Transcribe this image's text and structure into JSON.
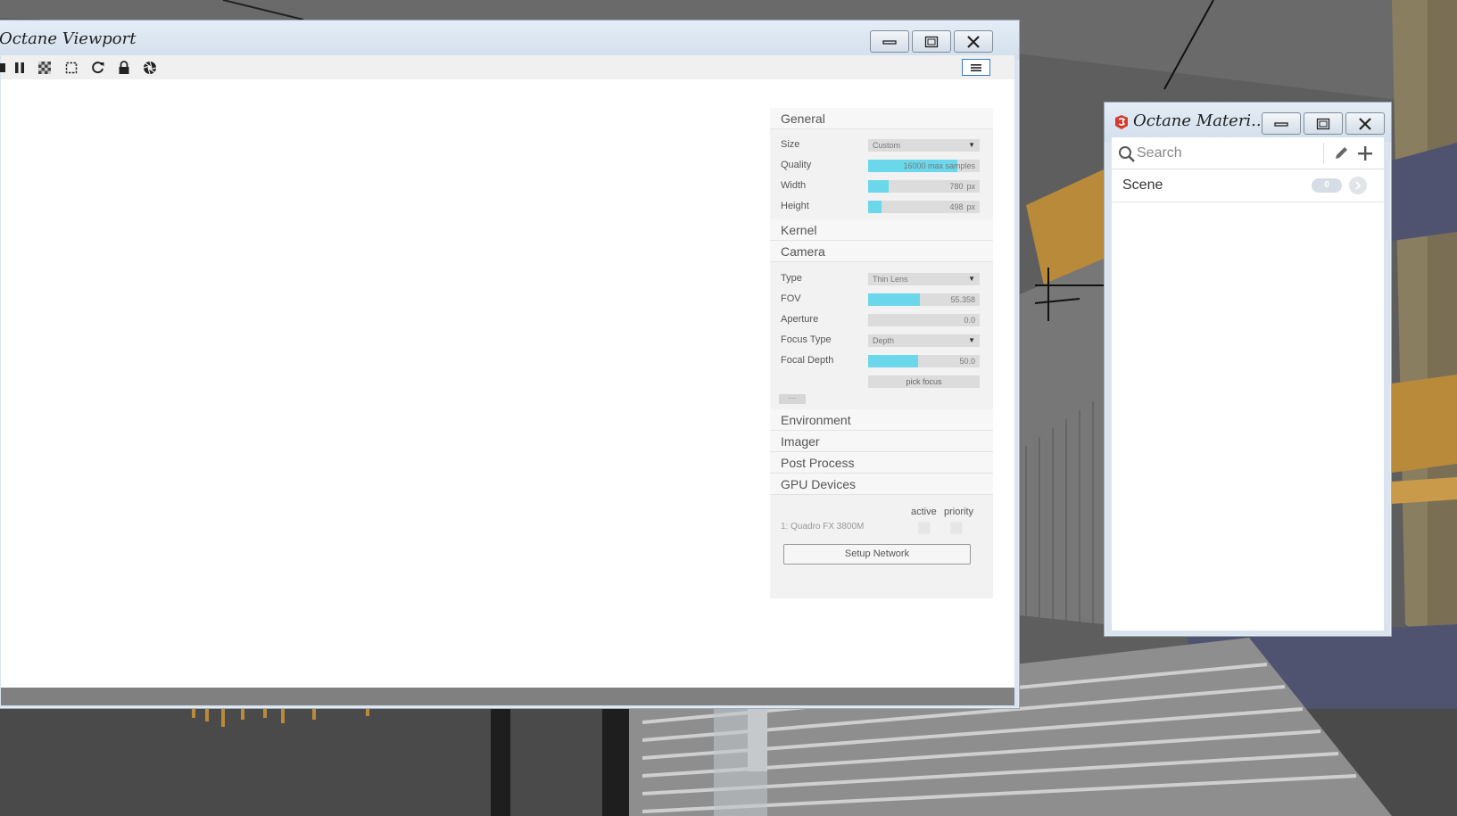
{
  "viewport": {
    "title": "Octane Viewport",
    "toolbar_icons": [
      "stop-icon",
      "pause-icon",
      "checker-icon",
      "region-select-icon",
      "restart-icon",
      "lock-icon",
      "aperture-icon",
      "hamburger-menu-icon"
    ]
  },
  "settings": {
    "general": {
      "header": "General",
      "size_label": "Size",
      "size_value": "Custom",
      "quality_label": "Quality",
      "quality_value": "16000 max samples",
      "quality_fill": 0.8,
      "width_label": "Width",
      "width_value": "780",
      "width_unit": "px",
      "width_fill": 0.18,
      "height_label": "Height",
      "height_value": "498",
      "height_unit": "px",
      "height_fill": 0.12
    },
    "kernel": {
      "header": "Kernel"
    },
    "camera": {
      "header": "Camera",
      "type_label": "Type",
      "type_value": "Thin Lens",
      "fov_label": "FOV",
      "fov_value": "55.358",
      "fov_fill": 0.46,
      "aperture_label": "Aperture",
      "aperture_value": "0.0",
      "aperture_fill": 0,
      "focus_type_label": "Focus Type",
      "focus_type_value": "Depth",
      "focal_depth_label": "Focal Depth",
      "focal_depth_value": "50.0",
      "focal_depth_fill": 0.45,
      "pick_focus_label": "pick focus",
      "more_label": "···"
    },
    "environment": {
      "header": "Environment"
    },
    "imager": {
      "header": "Imager"
    },
    "post_process": {
      "header": "Post Process"
    },
    "gpu_devices": {
      "header": "GPU Devices",
      "active_label": "active",
      "priority_label": "priority",
      "device_name": "1: Quadro FX 3800M",
      "setup_network_label": "Setup Network"
    }
  },
  "materials": {
    "title": "Octane Materi...",
    "search_placeholder": "Search",
    "scene_label": "Scene",
    "scene_count": "0"
  },
  "colors": {
    "accent_fill": "#6ad7ea",
    "window_frame": "#d9e4ef"
  }
}
